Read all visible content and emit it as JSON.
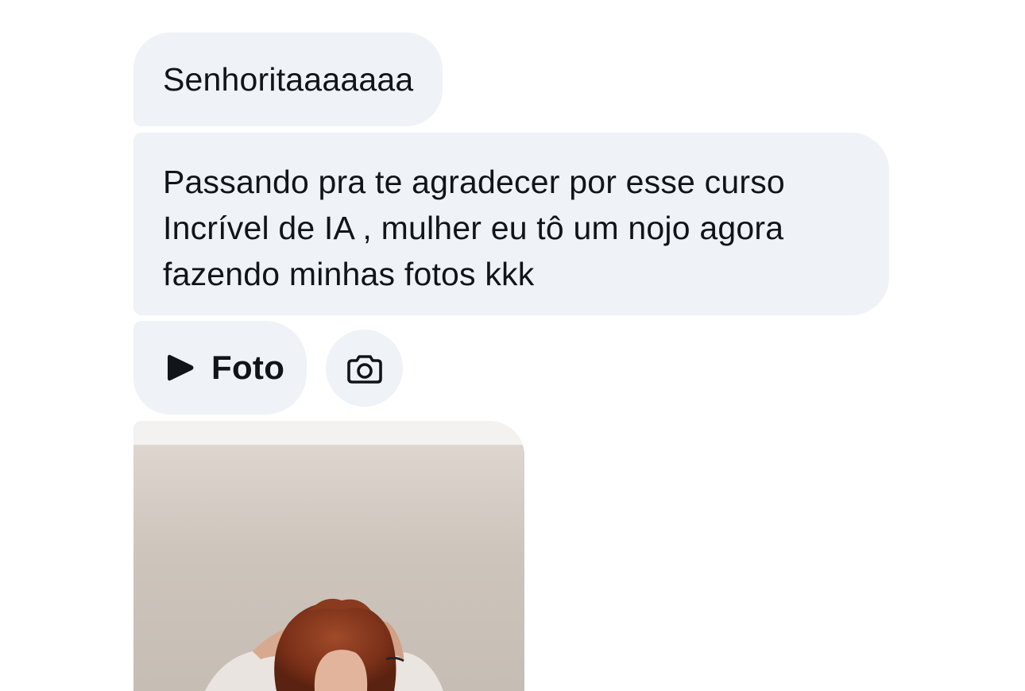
{
  "messages": [
    {
      "text": "Senhoritaaaaaaa"
    },
    {
      "lines": [
        "Passando pra te agradecer por esse curso",
        "Incrível de IA , mulher eu tô um nojo agora",
        "fazendo minhas fotos kkk"
      ]
    }
  ],
  "media": {
    "label": "Foto",
    "play_icon": "play-icon",
    "camera_icon": "camera-icon"
  },
  "colors": {
    "bubble": "#eff2f6",
    "text": "#111418",
    "background": "#ffffff"
  }
}
